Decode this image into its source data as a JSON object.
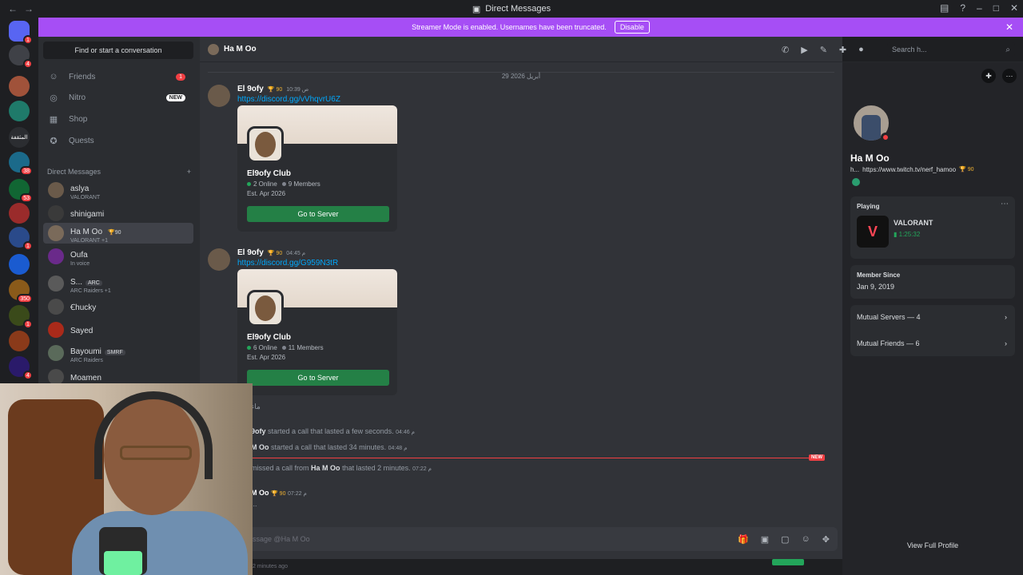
{
  "window": {
    "title": "Direct Messages"
  },
  "banner": {
    "text": "Streamer Mode is enabled. Usernames have been truncated.",
    "disable_label": "Disable"
  },
  "guilds": [
    {
      "label": "",
      "badge": "1",
      "color": "#5865f2"
    },
    {
      "label": "",
      "badge": "4",
      "color": "#3f4147"
    },
    {
      "label": "",
      "badge": "",
      "color": "#a0523a"
    },
    {
      "label": "",
      "badge": "",
      "color": "#1f7a6a"
    },
    {
      "label": "المثقفة",
      "badge": "",
      "color": "#2b2d31"
    },
    {
      "label": "",
      "badge": "38",
      "color": "#1b6a8a"
    },
    {
      "label": "",
      "badge": "53",
      "color": "#116633"
    },
    {
      "label": "",
      "badge": "",
      "color": "#9a2b2b"
    },
    {
      "label": "",
      "badge": "1",
      "color": "#2a4a8a"
    },
    {
      "label": "",
      "badge": "",
      "color": "#1a5bd0"
    },
    {
      "label": "",
      "badge": "350",
      "color": "#8a5a1a"
    },
    {
      "label": "",
      "badge": "1",
      "color": "#3a4a1a"
    },
    {
      "label": "",
      "badge": "",
      "color": "#8a3a1a"
    },
    {
      "label": "",
      "badge": "4",
      "color": "#2a1a6a"
    }
  ],
  "dm_panel": {
    "search_label": "Find or start a conversation",
    "nav": [
      {
        "label": "Friends",
        "icon": "friends-icon",
        "glyph": "☺",
        "pill": "1",
        "newpill": ""
      },
      {
        "label": "Nitro",
        "icon": "nitro-icon",
        "glyph": "◎",
        "pill": "",
        "newpill": "NEW"
      },
      {
        "label": "Shop",
        "icon": "shop-icon",
        "glyph": "▦",
        "pill": "",
        "newpill": ""
      },
      {
        "label": "Quests",
        "icon": "quests-icon",
        "glyph": "✪",
        "pill": "",
        "newpill": ""
      }
    ],
    "dm_header": "Direct Messages",
    "dm_add": "+",
    "dms": [
      {
        "name": "aslya",
        "sub": "VALORANT",
        "tag": "",
        "color": "#6a5a4a",
        "active": false
      },
      {
        "name": "shinigami",
        "sub": "",
        "tag": "",
        "color": "#3a3a3a",
        "active": false
      },
      {
        "name": "Ha M Oo",
        "sub": "VALORANT +1",
        "tag": "🏆90",
        "color": "#7a6a5a",
        "active": true
      },
      {
        "name": "Oufa",
        "sub": "In voice",
        "tag": "",
        "color": "#6a2a8a",
        "active": false
      },
      {
        "name": "S...",
        "sub": "ARC Raiders +1",
        "tag": "ARC",
        "color": "#5a5a5a",
        "active": false
      },
      {
        "name": "Ꞓhucky",
        "sub": "",
        "tag": "",
        "color": "#4a4a4a",
        "active": false
      },
      {
        "name": "Sayed",
        "sub": "",
        "tag": "",
        "color": "#aa2a1a",
        "active": false
      },
      {
        "name": "Bayoumi",
        "sub": "ARC Raiders",
        "tag": "SMRF",
        "color": "#5a6a5a",
        "active": false
      },
      {
        "name": "Moamen",
        "sub": "",
        "tag": "",
        "color": "#4a4a4a",
        "active": false
      }
    ]
  },
  "chat": {
    "header_name": "Ha M Oo",
    "search_placeholder": "Search h...",
    "date_divider": "29 أبريل 2026",
    "messages": [
      {
        "author": "El 9ofy",
        "trophy": "🏆 90",
        "time": "10:39 ص",
        "link": "https://discord.gg/vVhqvrU6Z",
        "server": "El9ofy Club",
        "online": "2 Online",
        "members": "9 Members",
        "est": "Est. Apr 2026",
        "btn": "Go to Server"
      },
      {
        "author": "El 9ofy",
        "trophy": "🏆 90",
        "time": "04:45 م",
        "link": "https://discord.gg/G959N3tR",
        "server": "El9ofy Club",
        "online": "6 Online",
        "members": "11 Members",
        "est": "Est. Apr 2026",
        "btn": "Go to Server"
      }
    ],
    "arabic_fragment": "ماء",
    "sys1": {
      "who": "9ofy",
      "text": "started a call that lasted a few seconds.",
      "time": "04:46 م"
    },
    "sys2": {
      "who": "M Oo",
      "text": "started a call that lasted 34 minutes.",
      "time": "04:48 م"
    },
    "new_tag": "NEW",
    "sys3": {
      "pre": "missed a call from",
      "who": "Ha M Oo",
      "text": "that lasted 2 minutes.",
      "time": "07:22 م"
    },
    "last_author": "M Oo",
    "last_trophy": "🏆 90",
    "last_time": "07:22 م",
    "last_text": "...",
    "composer_placeholder": "ssage @Ha M Oo",
    "bottom_time": "2 minutes ago"
  },
  "profile": {
    "name": "Ha M Oo",
    "bio_prefix": "h...",
    "bio_link": "https://www.twitch.tv/nerf_hamoo",
    "bio_trophy": "🏆 90",
    "playing_label": "Playing",
    "game": "VALORANT",
    "game_time": "1:25:32",
    "member_since_label": "Member Since",
    "member_since": "Jan 9, 2019",
    "mutual_servers": "Mutual Servers — 4",
    "mutual_friends": "Mutual Friends — 6",
    "view_full": "View Full Profile"
  },
  "colors": {
    "accent": "#a64ef5",
    "online": "#23a55a",
    "danger": "#f23f43",
    "link": "#00a8fc",
    "button_green": "#248046"
  }
}
